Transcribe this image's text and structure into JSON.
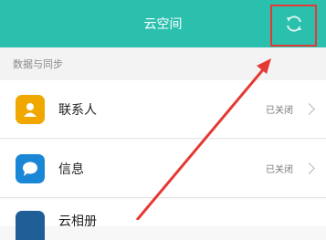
{
  "header": {
    "title": "云空间",
    "refresh_icon": "refresh-icon"
  },
  "section": {
    "label": "数据与同步"
  },
  "items": [
    {
      "label": "联系人",
      "status": "已关闭",
      "icon": "contacts-icon",
      "color": "#f0a800"
    },
    {
      "label": "信息",
      "status": "已关闭",
      "icon": "message-icon",
      "color": "#1a86d6"
    },
    {
      "label": "云相册",
      "icon": "album-icon",
      "color": "#1f5e97"
    }
  ],
  "colors": {
    "header": "#2bbfae",
    "annotation": "#e53935"
  }
}
